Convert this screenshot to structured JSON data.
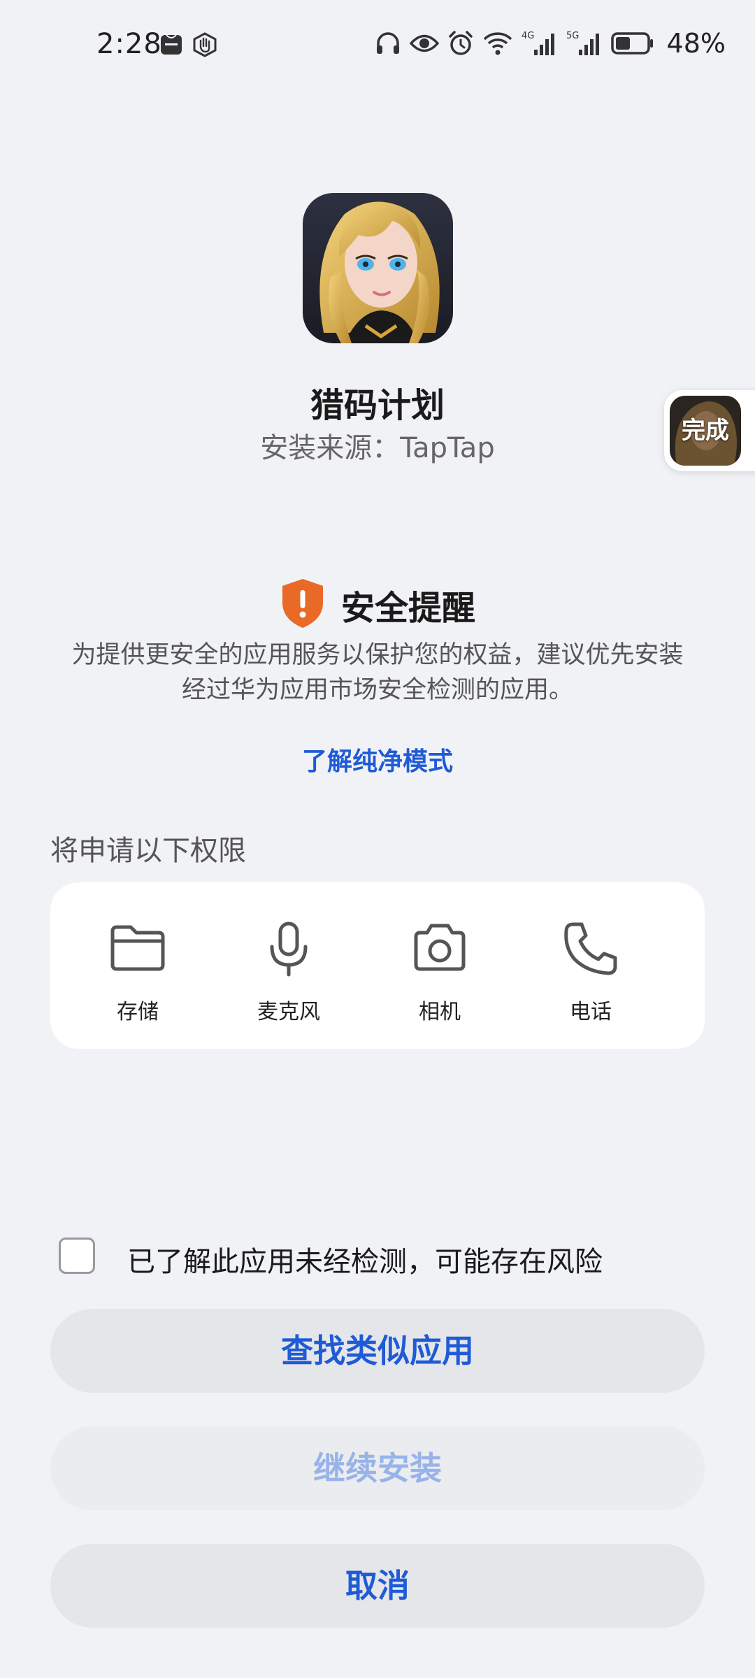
{
  "status_bar": {
    "time": "2:28",
    "network_4g": "4G",
    "network_5g": "5G",
    "battery_percent": "48%",
    "battery_level": 0.48,
    "icons": [
      "huawei-badge-icon",
      "hand-gesture-icon",
      "headphones-icon",
      "eye-comfort-icon",
      "alarm-icon",
      "wifi-icon",
      "signal-4g-icon",
      "signal-5g-icon",
      "battery-icon"
    ]
  },
  "app": {
    "name": "猎码计划",
    "install_source": "安装来源：TapTap"
  },
  "floating_button": {
    "label": "完成"
  },
  "security": {
    "title": "安全提醒",
    "body_line1": "为提供更安全的应用服务以保护您的权益，建议优先安装",
    "body_line2": "经过华为应用市场安全检测的应用。",
    "link": "了解纯净模式"
  },
  "permissions": {
    "heading": "将申请以下权限",
    "items": [
      {
        "label": "存储",
        "icon": "folder-icon"
      },
      {
        "label": "麦克风",
        "icon": "microphone-icon"
      },
      {
        "label": "相机",
        "icon": "camera-icon"
      },
      {
        "label": "电话",
        "icon": "phone-icon"
      }
    ]
  },
  "actions": {
    "acknowledge": "已了解此应用未经检测，可能存在风险",
    "acknowledge_checked": false,
    "find_similar": "查找类似应用",
    "continue_install": "继续安装",
    "cancel": "取消"
  },
  "colors": {
    "accent": "#1f5bd6",
    "disabled_accent": "#97b3ea",
    "warning": "#e86a26",
    "background": "#f1f2f5"
  }
}
